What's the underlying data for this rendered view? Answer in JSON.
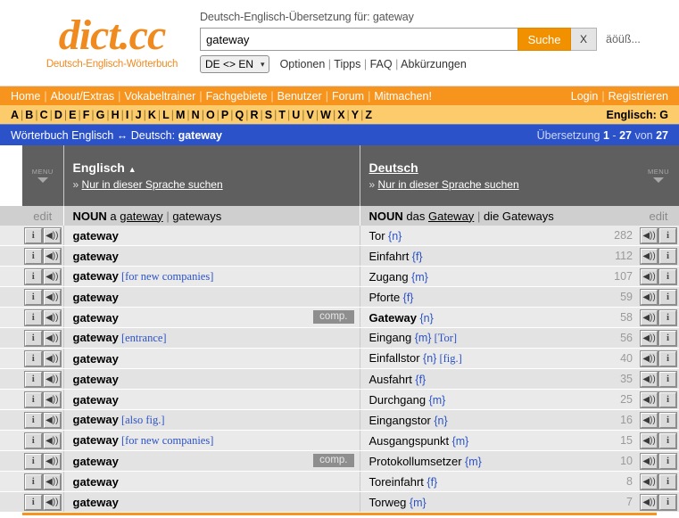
{
  "brand": {
    "name": "dict.cc",
    "tagline": "Deutsch-Englisch-Wörterbuch"
  },
  "search": {
    "caption": "Deutsch-Englisch-Übersetzung für: gateway",
    "value": "gateway",
    "placeholder": "",
    "submit_label": "Suche",
    "clear_label": "X",
    "umlaut_label": "äöüß...",
    "lang_pair": "DE <> EN",
    "links": [
      "Optionen",
      "Tipps",
      "FAQ",
      "Abkürzungen"
    ]
  },
  "nav": {
    "left": [
      "Home",
      "About/Extras",
      "Vokabeltrainer",
      "Fachgebiete",
      "Benutzer",
      "Forum",
      "Mitmachen!"
    ],
    "right": [
      "Login",
      "Registrieren"
    ]
  },
  "alphabet": {
    "letters": [
      "A",
      "B",
      "C",
      "D",
      "E",
      "F",
      "G",
      "H",
      "I",
      "J",
      "K",
      "L",
      "M",
      "N",
      "O",
      "P",
      "Q",
      "R",
      "S",
      "T",
      "U",
      "V",
      "W",
      "X",
      "Y",
      "Z"
    ],
    "current": "G",
    "right_label": "Englisch: G"
  },
  "titlebar": {
    "left_prefix": "Wörterbuch Englisch ↔ Deutsch:",
    "left_term": "gateway",
    "right_label": "Übersetzung",
    "right_from": "1",
    "right_dash": "-",
    "right_to": "27",
    "right_of": "von",
    "right_total": "27"
  },
  "columns": {
    "menu_label": "MENU",
    "left": {
      "title": "Englisch",
      "sort_indicator": "▲",
      "sub_link": "Nur in dieser Sprache suchen",
      "bullet": "»"
    },
    "right": {
      "title": "Deutsch",
      "sort_indicator": "",
      "sub_link": "Nur in dieser Sprache suchen",
      "bullet": "»"
    }
  },
  "noun_row": {
    "edit_left": "edit",
    "edit_right": "edit",
    "en_pos": "NOUN",
    "en_article": "a",
    "en_singular": "gateway",
    "en_sep": "|",
    "en_plural": "gateways",
    "de_pos": "NOUN",
    "de_article": "das",
    "de_singular": "Gateway",
    "de_sep": "|",
    "de_plural": "die Gateways"
  },
  "icons": {
    "info": "i",
    "speaker": "◀))"
  },
  "results": [
    {
      "en": "gateway",
      "en_note": "",
      "badge": "",
      "de": "Tor",
      "gender": "{n}",
      "de_note": "",
      "count": "282",
      "bold_de": false
    },
    {
      "en": "gateway",
      "en_note": "",
      "badge": "",
      "de": "Einfahrt",
      "gender": "{f}",
      "de_note": "",
      "count": "112",
      "bold_de": false
    },
    {
      "en": "gateway",
      "en_note": "[for new companies]",
      "badge": "",
      "de": "Zugang",
      "gender": "{m}",
      "de_note": "",
      "count": "107",
      "bold_de": false
    },
    {
      "en": "gateway",
      "en_note": "",
      "badge": "",
      "de": "Pforte",
      "gender": "{f}",
      "de_note": "",
      "count": "59",
      "bold_de": false
    },
    {
      "en": "gateway",
      "en_note": "",
      "badge": "comp.",
      "de": "Gateway",
      "gender": "{n}",
      "de_note": "",
      "count": "58",
      "bold_de": true
    },
    {
      "en": "gateway",
      "en_note": "[entrance]",
      "badge": "",
      "de": "Eingang",
      "gender": "{m}",
      "de_note": "[Tor]",
      "count": "56",
      "bold_de": false
    },
    {
      "en": "gateway",
      "en_note": "",
      "badge": "",
      "de": "Einfallstor",
      "gender": "{n}",
      "de_note": "[fig.]",
      "count": "40",
      "bold_de": false
    },
    {
      "en": "gateway",
      "en_note": "",
      "badge": "",
      "de": "Ausfahrt",
      "gender": "{f}",
      "de_note": "",
      "count": "35",
      "bold_de": false
    },
    {
      "en": "gateway",
      "en_note": "",
      "badge": "",
      "de": "Durchgang",
      "gender": "{m}",
      "de_note": "",
      "count": "25",
      "bold_de": false
    },
    {
      "en": "gateway",
      "en_note": "[also fig.]",
      "badge": "",
      "de": "Eingangstor",
      "gender": "{n}",
      "de_note": "",
      "count": "16",
      "bold_de": false
    },
    {
      "en": "gateway",
      "en_note": "[for new companies]",
      "badge": "",
      "de": "Ausgangspunkt",
      "gender": "{m}",
      "de_note": "",
      "count": "15",
      "bold_de": false
    },
    {
      "en": "gateway",
      "en_note": "",
      "badge": "comp.",
      "de": "Protokollumsetzer",
      "gender": "{m}",
      "de_note": "",
      "count": "10",
      "bold_de": false
    },
    {
      "en": "gateway",
      "en_note": "",
      "badge": "",
      "de": "Toreinfahrt",
      "gender": "{f}",
      "de_note": "",
      "count": "8",
      "bold_de": false
    },
    {
      "en": "gateway",
      "en_note": "",
      "badge": "",
      "de": "Torweg",
      "gender": "{m}",
      "de_note": "",
      "count": "7",
      "bold_de": false
    }
  ],
  "colors": {
    "brand_orange": "#F7941D",
    "alpha_bar": "#FCCB6B",
    "title_blue": "#2B52C8",
    "header_gray": "#5F5F5F"
  }
}
